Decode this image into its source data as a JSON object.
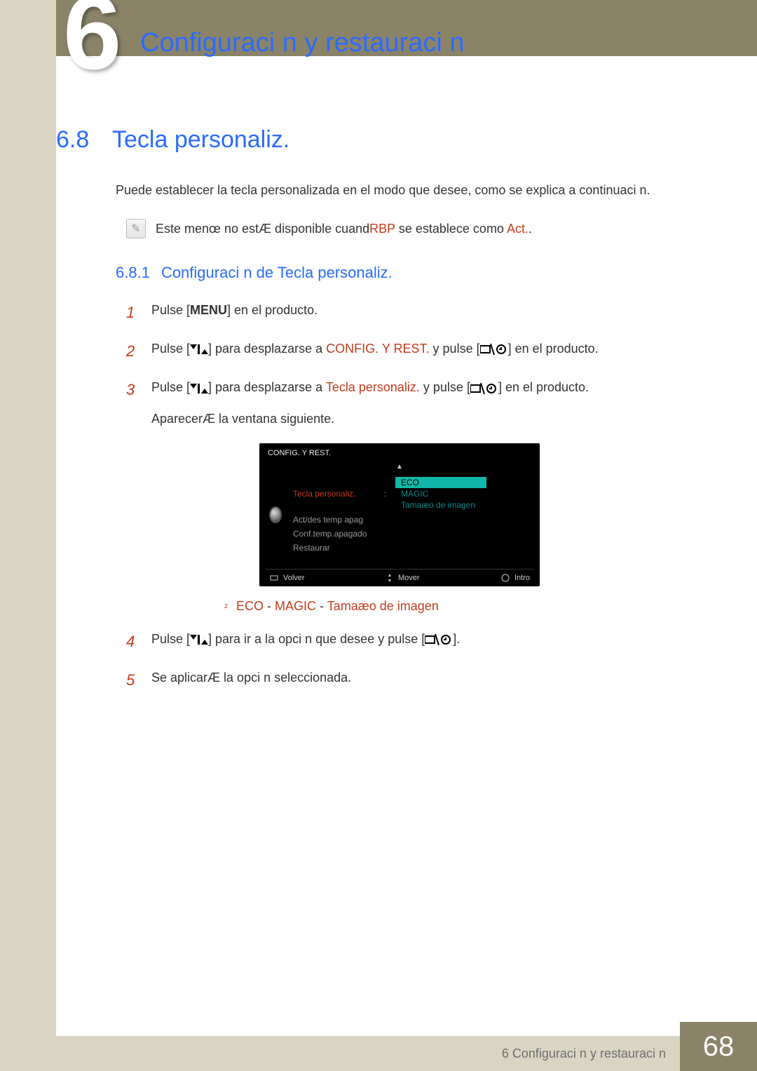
{
  "header": {
    "chapter_number": "6",
    "page_title": "Configuraci n y restauraci n"
  },
  "section": {
    "number": "6.8",
    "title": "Tecla personaliz.",
    "intro": "Puede establecer la tecla personalizada en el modo que desee, como se explica a continuaci n."
  },
  "note": {
    "prefix": "Este menœ no estÆ disponible cuand",
    "hl1": "RBP",
    "mid": " se establece como",
    "hl2": "Act.",
    "suffix": "."
  },
  "subsection": {
    "number": "6.8.1",
    "title": "Configuraci n de Tecla personaliz."
  },
  "steps": {
    "s1": {
      "num": "1",
      "a": "Pulse [",
      "menu": "MENU",
      "b": "] en el producto."
    },
    "s2": {
      "num": "2",
      "a": "Pulse [",
      "b": "] para desplazarse a",
      "hl": "CONFIG. Y REST.",
      "c": "y pulse [",
      "d": "] en el producto."
    },
    "s3": {
      "num": "3",
      "a": "Pulse [",
      "b": "] para desplazarse a",
      "hl": "Tecla personaliz.",
      "c": " y pulse [",
      "d": "] en el producto.",
      "sub": "AparecerÆ la ventana siguiente."
    },
    "s4": {
      "num": "4",
      "a": "Pulse [",
      "b": "] para ir a la opci n que desee y pulse",
      "c": "[",
      "d": "]."
    },
    "s5": {
      "num": "5",
      "text": "Se aplicarÆ la opci n seleccionada."
    }
  },
  "osd": {
    "title": "CONFIG. Y REST.",
    "menu": {
      "i0": "Tecla personaliz.",
      "i1": "Act/des temp apag",
      "i2": "Conf.temp.apagado",
      "i3": "Restaurar"
    },
    "options": {
      "o0": "ECO",
      "o1": "MAGIC",
      "o2": "Tamaæo de imagen"
    },
    "footer": {
      "back": "Volver",
      "move": "Mover",
      "enter": "Intro"
    }
  },
  "bullets": {
    "b0": {
      "o0": "ECO",
      "o1": "MAGIC",
      "o2": "Tamaæo de imagen"
    }
  },
  "footer": {
    "chapter": "6 Configuraci n y restauraci n",
    "page": "68"
  }
}
